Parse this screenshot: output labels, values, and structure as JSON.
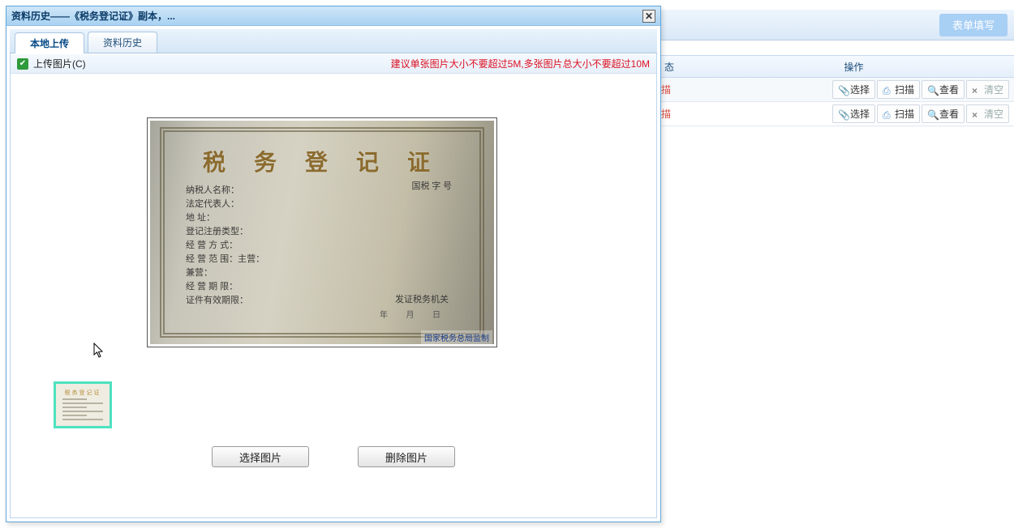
{
  "modal": {
    "title": "资料历史——《税务登记证》副本，...",
    "tabs": {
      "upload": "本地上传",
      "history": "资料历史"
    },
    "upload_bar": {
      "check_label": "上传图片(C)",
      "hint": "建议单张图片大小不要超过5M,多张图片总大小不要超过10M"
    },
    "buttons": {
      "choose": "选择图片",
      "delete": "删除图片"
    },
    "certificate": {
      "title": "税 务 登 记 证",
      "ref": "国税  字           号",
      "fields": [
        "纳税人名称：",
        "法定代表人：",
        "地        址：",
        "登记注册类型：",
        "经 营 方 式：",
        "经 营 范 围：主营：",
        "                    兼营：",
        "经 营 期 限：",
        "证件有效期限："
      ],
      "issuer": "发证税务机关",
      "date_line": "年     月     日",
      "stamp": "国家税务总局监制"
    }
  },
  "background": {
    "form_fill": "表单填写",
    "headers": {
      "status": "态",
      "ops": "操作"
    },
    "row_status": "描",
    "btn": {
      "select": "选择",
      "scan": "扫描",
      "view": "查看",
      "clear": "清空"
    }
  }
}
